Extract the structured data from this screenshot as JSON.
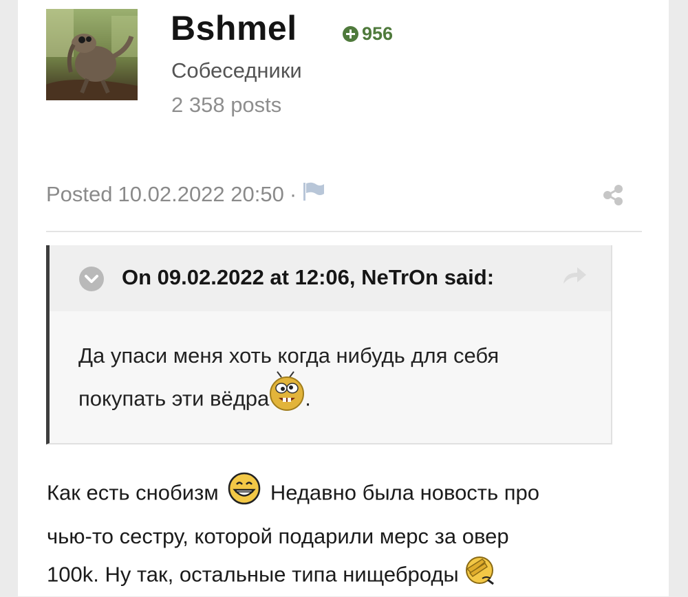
{
  "author": {
    "name": "Bshmel",
    "reputation": "956",
    "group": "Собеседники",
    "posts": "2 358 posts",
    "avatar_icon": "avatar-creature-photo"
  },
  "post": {
    "posted_label": "Posted",
    "date": "10.02.2022 20:50",
    "separator": "·",
    "report_icon": "flag-icon",
    "share_icon": "share-icon"
  },
  "quote": {
    "citation": "On 09.02.2022 at 12:06, NeTrOn said:",
    "line1": "Да упаси меня хоть когда нибудь для себя",
    "line2": "покупать эти вёдра",
    "line2_end": ".",
    "emoticon": "goofy-smiley-icon"
  },
  "content": {
    "line1_a": "Как есть снобизм",
    "line1_b": "Недавно была новость про",
    "line2": "чью-то сестру, которой подарили мерс за овер",
    "line3": "100k. Ну так, остальные типа нищеброды",
    "emoticons": [
      "grin-icon",
      "facepalm-icon"
    ]
  },
  "colors": {
    "reputation": "#4f7a3c",
    "quote_border": "#3d3d3d",
    "quote_header": "#efefef",
    "page_background": "#ebebeb"
  }
}
